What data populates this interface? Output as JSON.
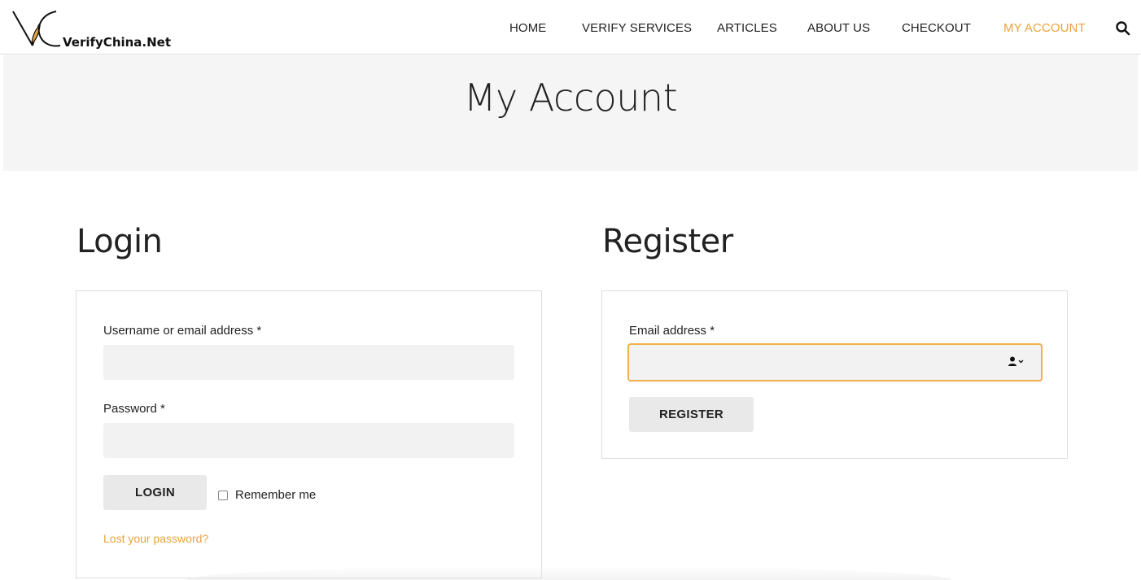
{
  "brand": {
    "name": "VerifyChina.Net",
    "accent_color": "#e8a33d"
  },
  "nav": {
    "items": [
      {
        "label": "HOME"
      },
      {
        "label": "VERIFY SERVICES"
      },
      {
        "label": "ARTICLES"
      },
      {
        "label": "ABOUT US"
      },
      {
        "label": "CHECKOUT"
      },
      {
        "label": "MY ACCOUNT",
        "active": true
      }
    ],
    "search_icon": "search-icon"
  },
  "page": {
    "title": "My Account"
  },
  "login": {
    "heading": "Login",
    "username_label": "Username or email address *",
    "username_value": "",
    "password_label": "Password *",
    "password_value": "",
    "button_label": "LOGIN",
    "remember_label": "Remember me",
    "remember_checked": false,
    "lost_password_link": "Lost your password?"
  },
  "register": {
    "heading": "Register",
    "email_label": "Email address *",
    "email_value": "",
    "autofill_icon": "contact-autofill-icon",
    "button_label": "REGISTER"
  }
}
